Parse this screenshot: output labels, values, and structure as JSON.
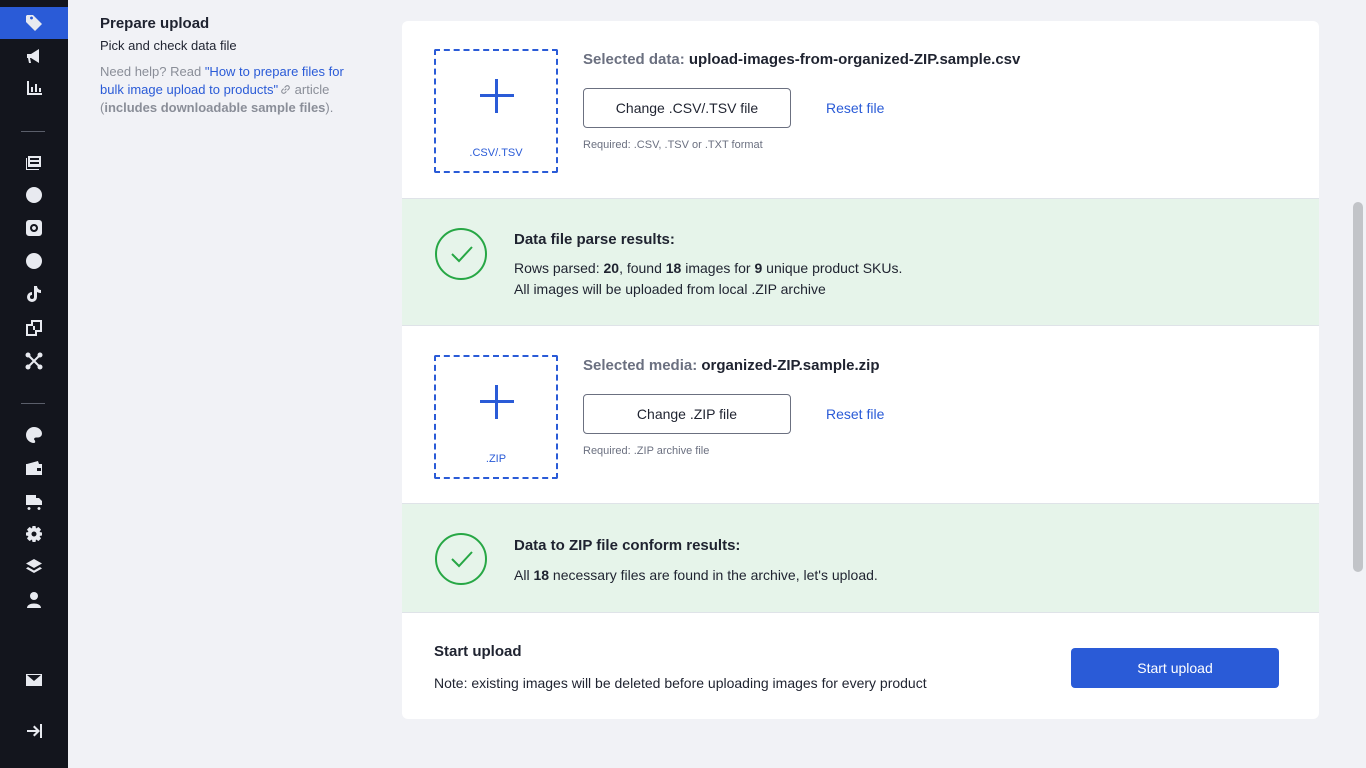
{
  "sidebar": {
    "icons": [
      "tag-icon",
      "megaphone-icon",
      "bar-chart-icon",
      "catalog-icon",
      "globe-icon",
      "instagram-icon",
      "facebook-icon",
      "tiktok-icon",
      "devices-icon",
      "network-icon",
      "palette-icon",
      "wallet-icon",
      "truck-icon",
      "gear-icon",
      "layers-icon",
      "user-icon",
      "mail-icon",
      "collapse-sidebar-icon"
    ]
  },
  "prepare": {
    "title": "Prepare upload",
    "subtitle": "Pick and check data file",
    "help_prefix": "Need help? Read ",
    "help_link": "\"How to prepare files for bulk image upload to products\"",
    "help_mid": " article",
    "help_paren_open": "(",
    "help_bold": "includes downloadable sample files",
    "help_paren_close": ")."
  },
  "data_file": {
    "dropzone_label": ".CSV/.TSV",
    "selected_label": "Selected data:",
    "selected_value": "upload-images-from-organized-ZIP.sample.csv",
    "change_button": "Change .CSV/.TSV file",
    "reset_button": "Reset file",
    "required": "Required: .CSV, .TSV or .TXT format"
  },
  "parse_results": {
    "title": "Data file parse results:",
    "rows_label": "Rows parsed: ",
    "rows_value": "20",
    "found_label": ", found ",
    "images_value": "18",
    "images_label": " images for ",
    "skus_value": "9",
    "skus_label": " unique product SKUs.",
    "line2": "All images will be uploaded from local .ZIP archive"
  },
  "media_file": {
    "dropzone_label": ".ZIP",
    "selected_label": "Selected media:",
    "selected_value": "organized-ZIP.sample.zip",
    "change_button": "Change .ZIP file",
    "reset_button": "Reset file",
    "required": "Required: .ZIP archive file"
  },
  "conform_results": {
    "title": "Data to ZIP file conform results:",
    "prefix": "All ",
    "count": "18",
    "suffix": " necessary files are found in the archive, let's upload."
  },
  "start_upload": {
    "title": "Start upload",
    "note": "Note: existing images will be deleted before uploading images for every product",
    "button": "Start upload"
  },
  "colors": {
    "accent": "#2a5bd7",
    "success": "#27a745",
    "success_bg": "#e6f4ea",
    "sidebar_bg": "#13151d"
  }
}
